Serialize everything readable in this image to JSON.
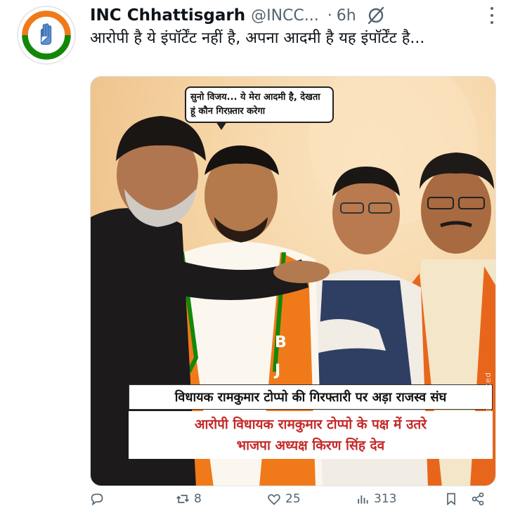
{
  "post": {
    "author_name": "INC Chhattisgarh",
    "author_handle": "@INCC...",
    "separator": "·",
    "time": "6h",
    "text": "आरोपी है ये इंपॉर्टेंट नहीं है, अपना आदमी है यह इंपॉर्टेंट है..."
  },
  "image": {
    "speech_bubble": "सुनो विजय... ये मेरा आदमी है, देखता हूं कौन गिरफ़्तार करेगा",
    "headline_top": "विधायक रामकुमार टोप्पो की गिरफ्तारी पर अड़ा राजस्व संघ",
    "headline_bottom_line1": "आरोपी विधायक रामकुमार टोप्पो के पक्ष में उतरे",
    "headline_bottom_line2": "भाजपा अध्यक्ष किरण सिंह देव",
    "ai_label": "AI Generated",
    "scarf_letters": [
      "B",
      "J",
      "B",
      "J"
    ]
  },
  "actions": {
    "reply_count": "",
    "repost_count": "8",
    "like_count": "25",
    "views_count": "313"
  },
  "icons": {
    "reply": "reply-icon",
    "repost": "repost-icon",
    "like": "heart-icon",
    "views": "views-icon",
    "bookmark": "bookmark-icon",
    "share": "share-icon",
    "grok": "grok-icon",
    "more": "more-icon"
  },
  "colors": {
    "text_primary": "#0f1419",
    "text_secondary": "#536471",
    "headline_red": "#c62828",
    "saffron": "#f07a1a",
    "congress_green": "#138808"
  }
}
